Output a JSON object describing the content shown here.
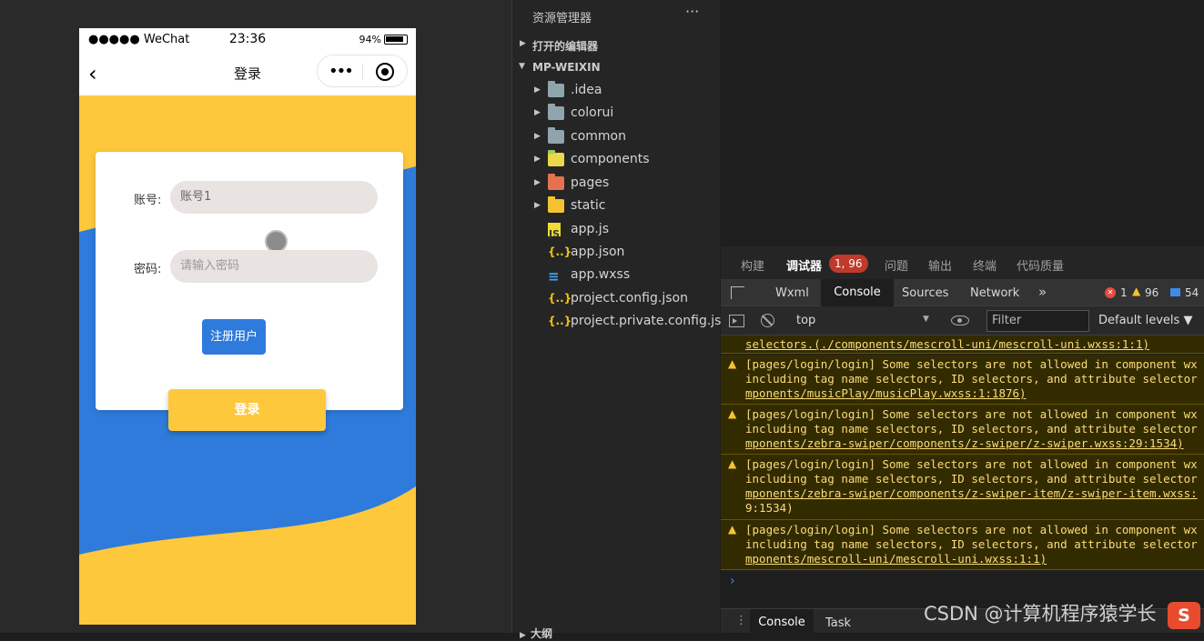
{
  "simulator": {
    "statusbar": {
      "carrier": "●●●●● WeChat",
      "time": "23:36",
      "battery": "94%"
    },
    "nav": {
      "back": "‹",
      "title": "登录",
      "more": "•••"
    },
    "form": {
      "account_label": "账号:",
      "account_value": "账号1",
      "password_label": "密码:",
      "password_placeholder": "请输入密码",
      "register_button": "注册用户",
      "login_button": "登录"
    },
    "colors": {
      "yellow": "#fec83d",
      "blue": "#2f7bdc"
    }
  },
  "explorer": {
    "title": "资源管理器",
    "more": "···",
    "section_open_editors": "打开的编辑器",
    "section_project": "MP-WEIXIN",
    "section_outline": "大纲",
    "items": [
      {
        "name": ".idea",
        "icon": "folder-icon"
      },
      {
        "name": "colorui",
        "icon": "folder-icon"
      },
      {
        "name": "common",
        "icon": "folder-icon"
      },
      {
        "name": "components",
        "icon": "components-folder-icon"
      },
      {
        "name": "pages",
        "icon": "pages-folder-icon"
      },
      {
        "name": "static",
        "icon": "static-folder-icon"
      },
      {
        "name": "app.js",
        "icon": "js-file-icon"
      },
      {
        "name": "app.json",
        "icon": "json-file-icon"
      },
      {
        "name": "app.wxss",
        "icon": "css-file-icon"
      },
      {
        "name": "project.config.json",
        "icon": "json-file-icon"
      },
      {
        "name": "project.private.config.js...",
        "icon": "json-file-icon"
      }
    ]
  },
  "devtools": {
    "top_tabs": [
      "构建",
      "调试器",
      "问题",
      "输出",
      "终端",
      "代码质量"
    ],
    "badge": "1, 96",
    "panel_tabs": {
      "wxml": "Wxml",
      "console": "Console",
      "sources": "Sources",
      "network": "Network",
      "more": "»"
    },
    "counts": {
      "errors": "1",
      "warnings": "96",
      "info": "54"
    },
    "toolbar": {
      "context": "top",
      "filter_placeholder": "Filter",
      "levels": "Default levels ▼"
    },
    "logs": [
      {
        "lines": [
          "selectors.(./components/mescroll-uni/mescroll-uni.wxss:1:1)"
        ]
      },
      {
        "lines": [
          "[pages/login/login] Some selectors are not allowed in component wx",
          "including tag name selectors, ID selectors, and attribute selector",
          "mponents/musicPlay/musicPlay.wxss:1:1876)"
        ]
      },
      {
        "lines": [
          "[pages/login/login] Some selectors are not allowed in component wx",
          "including tag name selectors, ID selectors, and attribute selector",
          "mponents/zebra-swiper/components/z-swiper/z-swiper.wxss:29:1534)"
        ]
      },
      {
        "lines": [
          "[pages/login/login] Some selectors are not allowed in component wx",
          "including tag name selectors, ID selectors, and attribute selector",
          "mponents/zebra-swiper/components/z-swiper-item/z-swiper-item.wxss:",
          "9:1534)"
        ]
      },
      {
        "lines": [
          "[pages/login/login] Some selectors are not allowed in component wx",
          "including tag name selectors, ID selectors, and attribute selector",
          "mponents/mescroll-uni/mescroll-uni.wxss:1:1)"
        ]
      }
    ],
    "prompt": "›",
    "drawer": {
      "console": "Console",
      "task": "Task"
    }
  },
  "watermark": "CSDN @计算机程序猿学长",
  "watermark_logo": "S"
}
